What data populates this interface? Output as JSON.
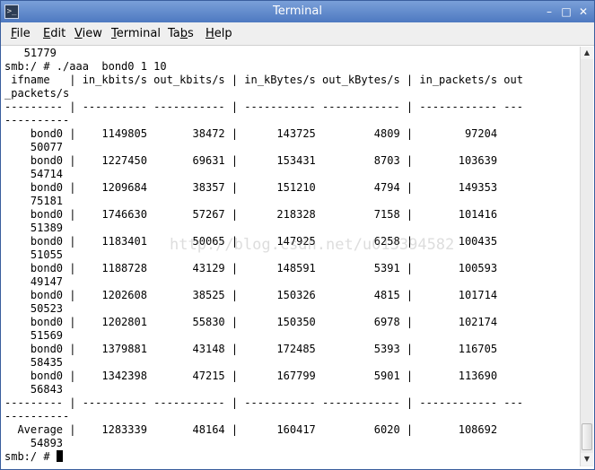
{
  "window": {
    "title": "Terminal",
    "icon_glyph": ">_",
    "controls": {
      "minimize": "–",
      "maximize": "□",
      "close": "✕"
    }
  },
  "menu": {
    "file": {
      "mnemonic": "F",
      "rest": "ile"
    },
    "edit": {
      "mnemonic": "E",
      "rest": "dit"
    },
    "view": {
      "mnemonic": "V",
      "rest": "iew"
    },
    "terminal": {
      "mnemonic": "T",
      "rest": "erminal"
    },
    "tabs": {
      "pre": "Ta",
      "mnemonic": "b",
      "rest": "s"
    },
    "help": {
      "mnemonic": "H",
      "rest": "elp"
    }
  },
  "terminal": {
    "lines": [
      "   51779",
      "smb:/ # ./aaa  bond0 1 10",
      " ifname   | in_kbits/s out_kbits/s | in_kBytes/s out_kBytes/s | in_packets/s out",
      "_packets/s",
      "--------- | ---------- ----------- | ----------- ------------ | ------------ ---",
      "----------",
      "    bond0 |    1149805       38472 |      143725         4809 |        97204",
      "    50077",
      "    bond0 |    1227450       69631 |      153431         8703 |       103639",
      "    54714",
      "    bond0 |    1209684       38357 |      151210         4794 |       149353",
      "    75181",
      "    bond0 |    1746630       57267 |      218328         7158 |       101416",
      "    51389",
      "    bond0 |    1183401       50065 |      147925         6258 |       100435",
      "    51055",
      "    bond0 |    1188728       43129 |      148591         5391 |       100593",
      "    49147",
      "    bond0 |    1202608       38525 |      150326         4815 |       101714",
      "    50523",
      "    bond0 |    1202801       55830 |      150350         6978 |       102174",
      "    51569",
      "    bond0 |    1379881       43148 |      172485         5393 |       116705",
      "    58435",
      "    bond0 |    1342398       47215 |      167799         5901 |       113690",
      "    56843",
      "--------- | ---------- ----------- | ----------- ------------ | ------------ ---",
      "----------",
      "  Average |    1283339       48164 |      160417         6020 |       108692",
      "    54893"
    ],
    "prompt": "smb:/ # "
  },
  "watermark": "http://blog.csdn.net/u013394582",
  "scrollbar": {
    "up_arrow": "▲",
    "down_arrow": "▼"
  }
}
